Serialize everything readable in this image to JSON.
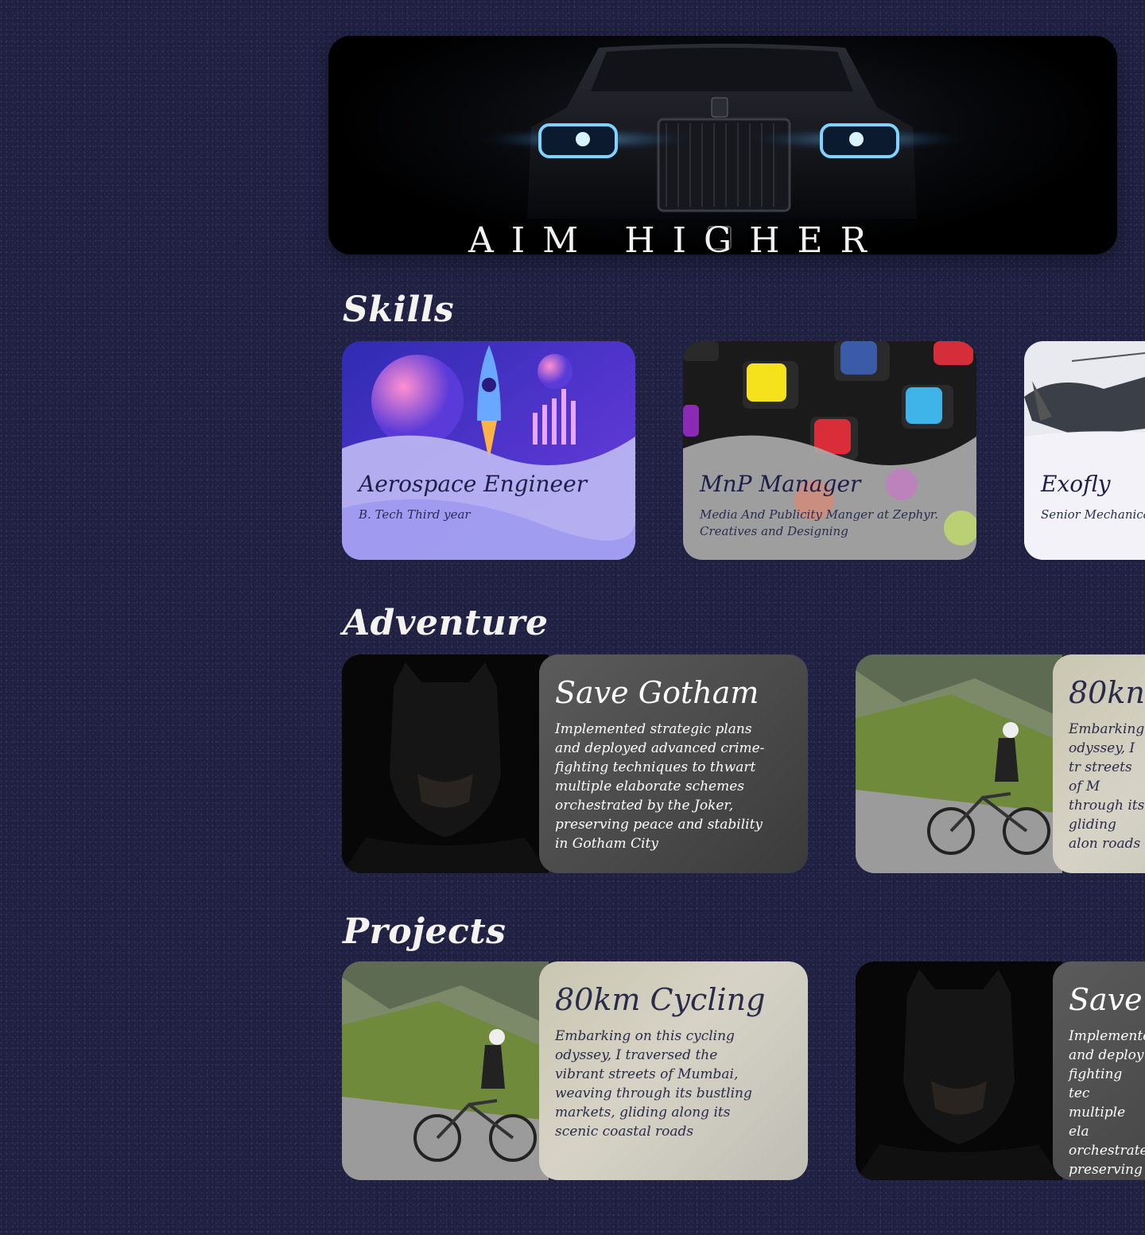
{
  "hero": {
    "title": "AIM HIGHER"
  },
  "sections": {
    "skills": "Skills",
    "adventure": "Adventure",
    "projects": "Projects"
  },
  "skills": [
    {
      "title": "Aerospace Engineer",
      "subtitle": "B. Tech Third year",
      "image": "rocket-illustration"
    },
    {
      "title": "MnP Manager",
      "subtitle": "Media And Publicity Manger at Zephyr. Creatives and Designing",
      "image": "social-media-keys"
    },
    {
      "title": "Exofly",
      "subtitle": "Senior Mechanica",
      "image": "drone-photo"
    }
  ],
  "adventure": [
    {
      "title": "Save Gotham",
      "description": "Implemented strategic plans and deployed advanced crime-fighting techniques to thwart multiple elaborate schemes orchestrated by the Joker, preserving peace and stability in Gotham City",
      "image": "batman-portrait"
    },
    {
      "title": "80kn",
      "description": "Embarking odyssey, I tr streets of M through its gliding alon roads",
      "image": "cyclist-photo"
    }
  ],
  "projects": [
    {
      "title": "80km Cycling",
      "description": "Embarking on this cycling odyssey, I traversed the vibrant streets of Mumbai, weaving through its bustling markets, gliding along its scenic coastal roads",
      "image": "cyclist-photo"
    },
    {
      "title": "Save",
      "description": "Implemente and deploy fighting tec multiple ela orchestrate preserving in Gotham",
      "image": "batman-portrait"
    }
  ],
  "colors": {
    "background": "#1f2042",
    "card_title": "#1d1f4a",
    "panel_dark": "#4a4a4a",
    "panel_light": "#d6d3c6"
  }
}
